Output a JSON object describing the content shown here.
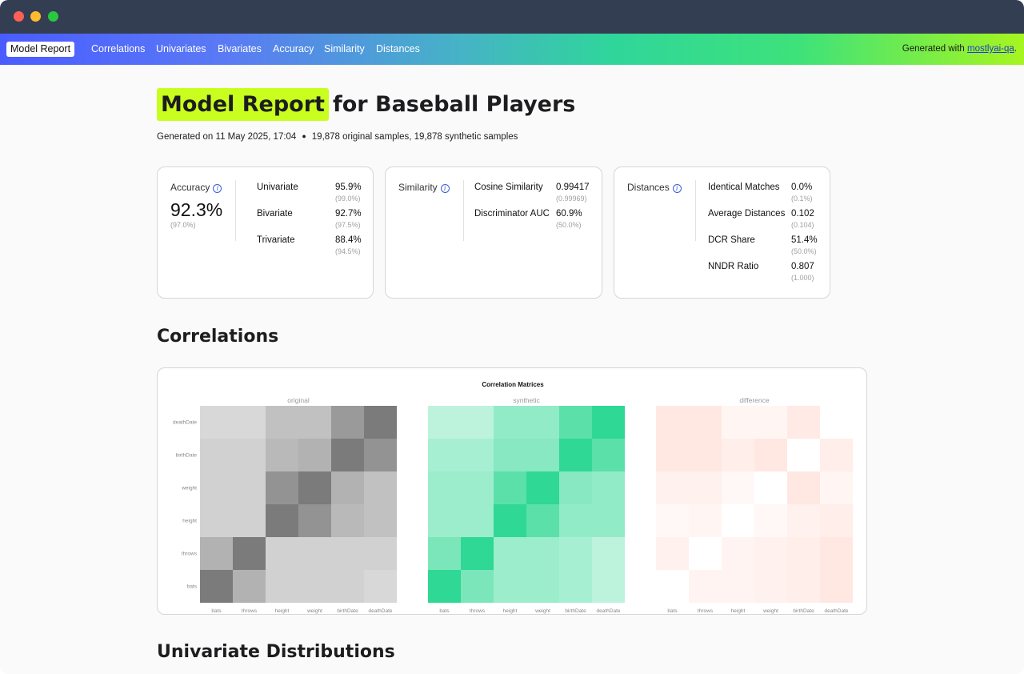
{
  "window": {
    "traffic_lights": [
      "close",
      "minimize",
      "maximize"
    ]
  },
  "nav": {
    "brand": "Model Report",
    "links": [
      "Correlations",
      "Univariates",
      "Bivariates",
      "Accuracy",
      "Similarity",
      "Distances"
    ],
    "generated_prefix": "Generated with ",
    "generated_link": "mostlyai-qa",
    "generated_suffix": "."
  },
  "header": {
    "title_highlight": "Model Report",
    "title_rest": "for Baseball Players",
    "generated_on": "Generated on 11 May 2025, 17:04",
    "samples": "19,878 original samples, 19,878 synthetic samples"
  },
  "cards": {
    "accuracy": {
      "label": "Accuracy",
      "value": "92.3%",
      "sub": "(97.0%)",
      "metrics": [
        {
          "name": "Univariate",
          "value": "95.9%",
          "sub": "(99.0%)"
        },
        {
          "name": "Bivariate",
          "value": "92.7%",
          "sub": "(97.5%)"
        },
        {
          "name": "Trivariate",
          "value": "88.4%",
          "sub": "(94.5%)"
        }
      ]
    },
    "similarity": {
      "label": "Similarity",
      "metrics": [
        {
          "name": "Cosine Similarity",
          "value": "0.99417",
          "sub": "(0.99969)"
        },
        {
          "name": "Discriminator AUC",
          "value": "60.9%",
          "sub": "(50.0%)"
        }
      ]
    },
    "distances": {
      "label": "Distances",
      "metrics": [
        {
          "name": "Identical Matches",
          "value": "0.0%",
          "sub": "(0.1%)"
        },
        {
          "name": "Average Distances",
          "value": "0.102",
          "sub": "(0.104)"
        },
        {
          "name": "DCR Share",
          "value": "51.4%",
          "sub": "(50.0%)"
        },
        {
          "name": "NNDR Ratio",
          "value": "0.807",
          "sub": "(1.000)"
        }
      ]
    }
  },
  "sections": {
    "correlations": "Correlations",
    "univariates": "Univariate Distributions"
  },
  "chart_data": {
    "type": "heatmap",
    "title": "Correlation Matrices",
    "variables": [
      "bats",
      "throws",
      "height",
      "weight",
      "birthDate",
      "deathDate"
    ],
    "row_labels_top_to_bottom": [
      "deathDate",
      "birthDate",
      "weight",
      "height",
      "throws",
      "bats"
    ],
    "colors": {
      "original": "#646464",
      "synthetic": "#24d68e",
      "difference": "#ff8c6e"
    },
    "panels": [
      {
        "name": "original",
        "values": [
          [
            0.25,
            0.25,
            0.4,
            0.4,
            0.65,
            0.85
          ],
          [
            0.3,
            0.3,
            0.45,
            0.5,
            0.85,
            0.7
          ],
          [
            0.3,
            0.3,
            0.7,
            0.85,
            0.5,
            0.4
          ],
          [
            0.3,
            0.3,
            0.85,
            0.7,
            0.45,
            0.4
          ],
          [
            0.5,
            0.85,
            0.3,
            0.3,
            0.3,
            0.3
          ],
          [
            0.85,
            0.5,
            0.3,
            0.3,
            0.3,
            0.25
          ]
        ]
      },
      {
        "name": "synthetic",
        "values": [
          [
            0.3,
            0.3,
            0.5,
            0.5,
            0.75,
            0.95
          ],
          [
            0.4,
            0.4,
            0.55,
            0.55,
            0.95,
            0.75
          ],
          [
            0.45,
            0.45,
            0.75,
            0.95,
            0.55,
            0.5
          ],
          [
            0.45,
            0.45,
            0.95,
            0.75,
            0.5,
            0.5
          ],
          [
            0.6,
            0.95,
            0.45,
            0.45,
            0.4,
            0.3
          ],
          [
            0.95,
            0.6,
            0.45,
            0.45,
            0.4,
            0.3
          ]
        ]
      },
      {
        "name": "difference",
        "values": [
          [
            0.2,
            0.2,
            0.08,
            0.08,
            0.18,
            0.0
          ],
          [
            0.2,
            0.2,
            0.15,
            0.2,
            0.0,
            0.15
          ],
          [
            0.12,
            0.12,
            0.06,
            0.0,
            0.2,
            0.08
          ],
          [
            0.06,
            0.08,
            0.0,
            0.06,
            0.12,
            0.15
          ],
          [
            0.12,
            0.0,
            0.1,
            0.12,
            0.15,
            0.2
          ],
          [
            0.0,
            0.1,
            0.1,
            0.12,
            0.15,
            0.2
          ]
        ]
      }
    ]
  }
}
